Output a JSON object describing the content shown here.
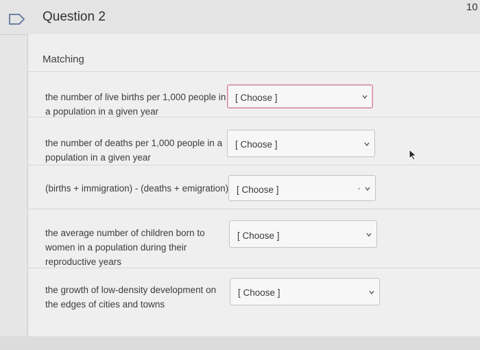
{
  "header": {
    "question_title": "Question 2",
    "points": "10"
  },
  "question": {
    "type_label": "Matching",
    "rows": [
      {
        "prompt_line1": "the number of live births per 1,000 people in",
        "prompt_line2": "a population in a given year",
        "select_value": "[ Choose ]"
      },
      {
        "prompt_line1": "the number of deaths per 1,000 people in a",
        "prompt_line2": "population in a given year",
        "select_value": "[ Choose ]"
      },
      {
        "prompt_line1": "(births + immigration) - (deaths + emigration)",
        "select_value": "[ Choose ]"
      },
      {
        "prompt_line1": "the average number of children born to",
        "prompt_line2": "women in a population during their",
        "prompt_line3": "reproductive years",
        "select_value": "[ Choose ]"
      },
      {
        "prompt_line1": "the growth of low-density development on",
        "prompt_line2": "the edges of cities and towns",
        "select_value": "[ Choose ]"
      }
    ]
  },
  "colors": {
    "active_select_border": "#d08a98",
    "flag_outline": "#6b7fa3"
  },
  "icons": {
    "flag": "flag-icon",
    "chevron": "chevron-down-icon",
    "cursor": "mouse-cursor-icon"
  }
}
